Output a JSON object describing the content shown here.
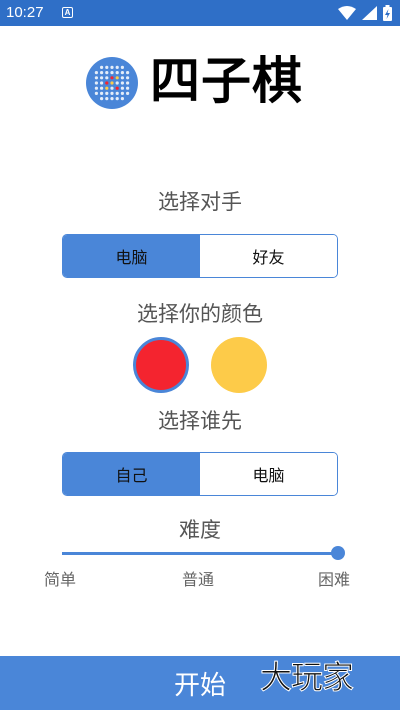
{
  "status_bar": {
    "time": "10:27",
    "notification_glyph": "A",
    "icons": [
      "wifi-icon",
      "signal-icon",
      "battery-charging-icon"
    ],
    "background": "#2f6fc7"
  },
  "header": {
    "title": "四子棋",
    "logo_icon": "connect-four-board-icon"
  },
  "opponent": {
    "label": "选择对手",
    "options": [
      "电脑",
      "好友"
    ],
    "selected": "电脑"
  },
  "color": {
    "label": "选择你的颜色",
    "options": [
      {
        "name": "red",
        "hex": "#f4242f",
        "selected": true
      },
      {
        "name": "yellow",
        "hex": "#fdcb49",
        "selected": false
      }
    ]
  },
  "first": {
    "label": "选择谁先",
    "options": [
      "自己",
      "电脑"
    ],
    "selected": "自己"
  },
  "difficulty": {
    "label": "难度",
    "levels": [
      "简单",
      "普通",
      "困难"
    ],
    "selected": "困难",
    "value_fraction": 1.0
  },
  "start_button": {
    "label": "开始"
  },
  "watermark": {
    "text": "大玩家"
  },
  "colors": {
    "accent": "#4a86d8",
    "status_bar": "#2f6fc7"
  }
}
